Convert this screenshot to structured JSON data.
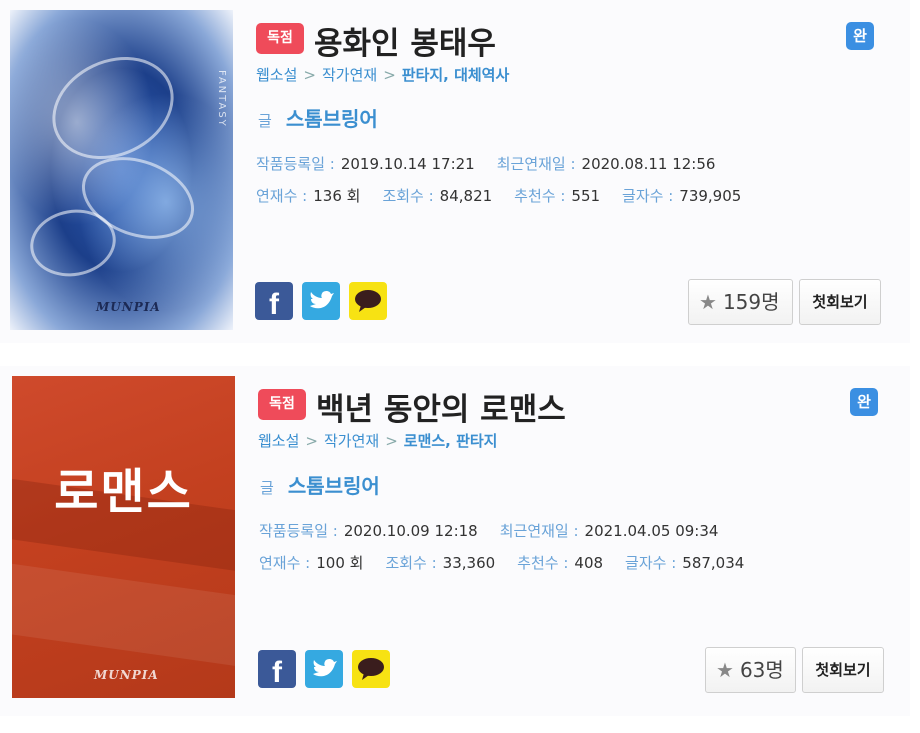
{
  "novels": [
    {
      "exclusive_tag": "독점",
      "title": "용화인 봉태우",
      "complete_badge": "완",
      "breadcrumb": [
        "웹소설",
        "작가연재",
        "판타지, 대체역사"
      ],
      "author_label": "글",
      "author": "스톰브링어",
      "registered_label": "작품등록일 :",
      "registered": "2019.10.14 17:21",
      "last_update_label": "최근연재일 :",
      "last_update": "2020.08.11 12:56",
      "episodes_label": "연재수 :",
      "episodes": "136 회",
      "views_label": "조회수 :",
      "views": "84,821",
      "recommends_label": "추천수 :",
      "recommends": "551",
      "chars_label": "글자수 :",
      "chars": "739,905",
      "favorites": "159명",
      "first_episode_label": "첫회보기",
      "cover": {
        "logo": "MUNPIA",
        "side_text": "FANTASY"
      }
    },
    {
      "exclusive_tag": "독점",
      "title": "백년 동안의 로맨스",
      "complete_badge": "완",
      "breadcrumb": [
        "웹소설",
        "작가연재",
        "로맨스, 판타지"
      ],
      "author_label": "글",
      "author": "스톰브링어",
      "registered_label": "작품등록일 :",
      "registered": "2020.10.09 12:18",
      "last_update_label": "최근연재일 :",
      "last_update": "2021.04.05 09:34",
      "episodes_label": "연재수 :",
      "episodes": "100 회",
      "views_label": "조회수 :",
      "views": "33,360",
      "recommends_label": "추천수 :",
      "recommends": "408",
      "chars_label": "글자수 :",
      "chars": "587,034",
      "favorites": "63명",
      "first_episode_label": "첫회보기",
      "cover": {
        "title": "로맨스",
        "logo": "MUNPIA"
      }
    }
  ],
  "icons": {
    "facebook": "facebook-icon",
    "twitter": "twitter-icon",
    "kakaotalk": "kakaotalk-icon",
    "star": "star-icon"
  },
  "colors": {
    "exclusive": "#ef4b5a",
    "complete": "#3b8fe2",
    "link": "#3b8fd0",
    "facebook": "#3b5998",
    "twitter": "#35a9e1",
    "kakao": "#f7e213",
    "romance_cover": "#c3401f"
  }
}
